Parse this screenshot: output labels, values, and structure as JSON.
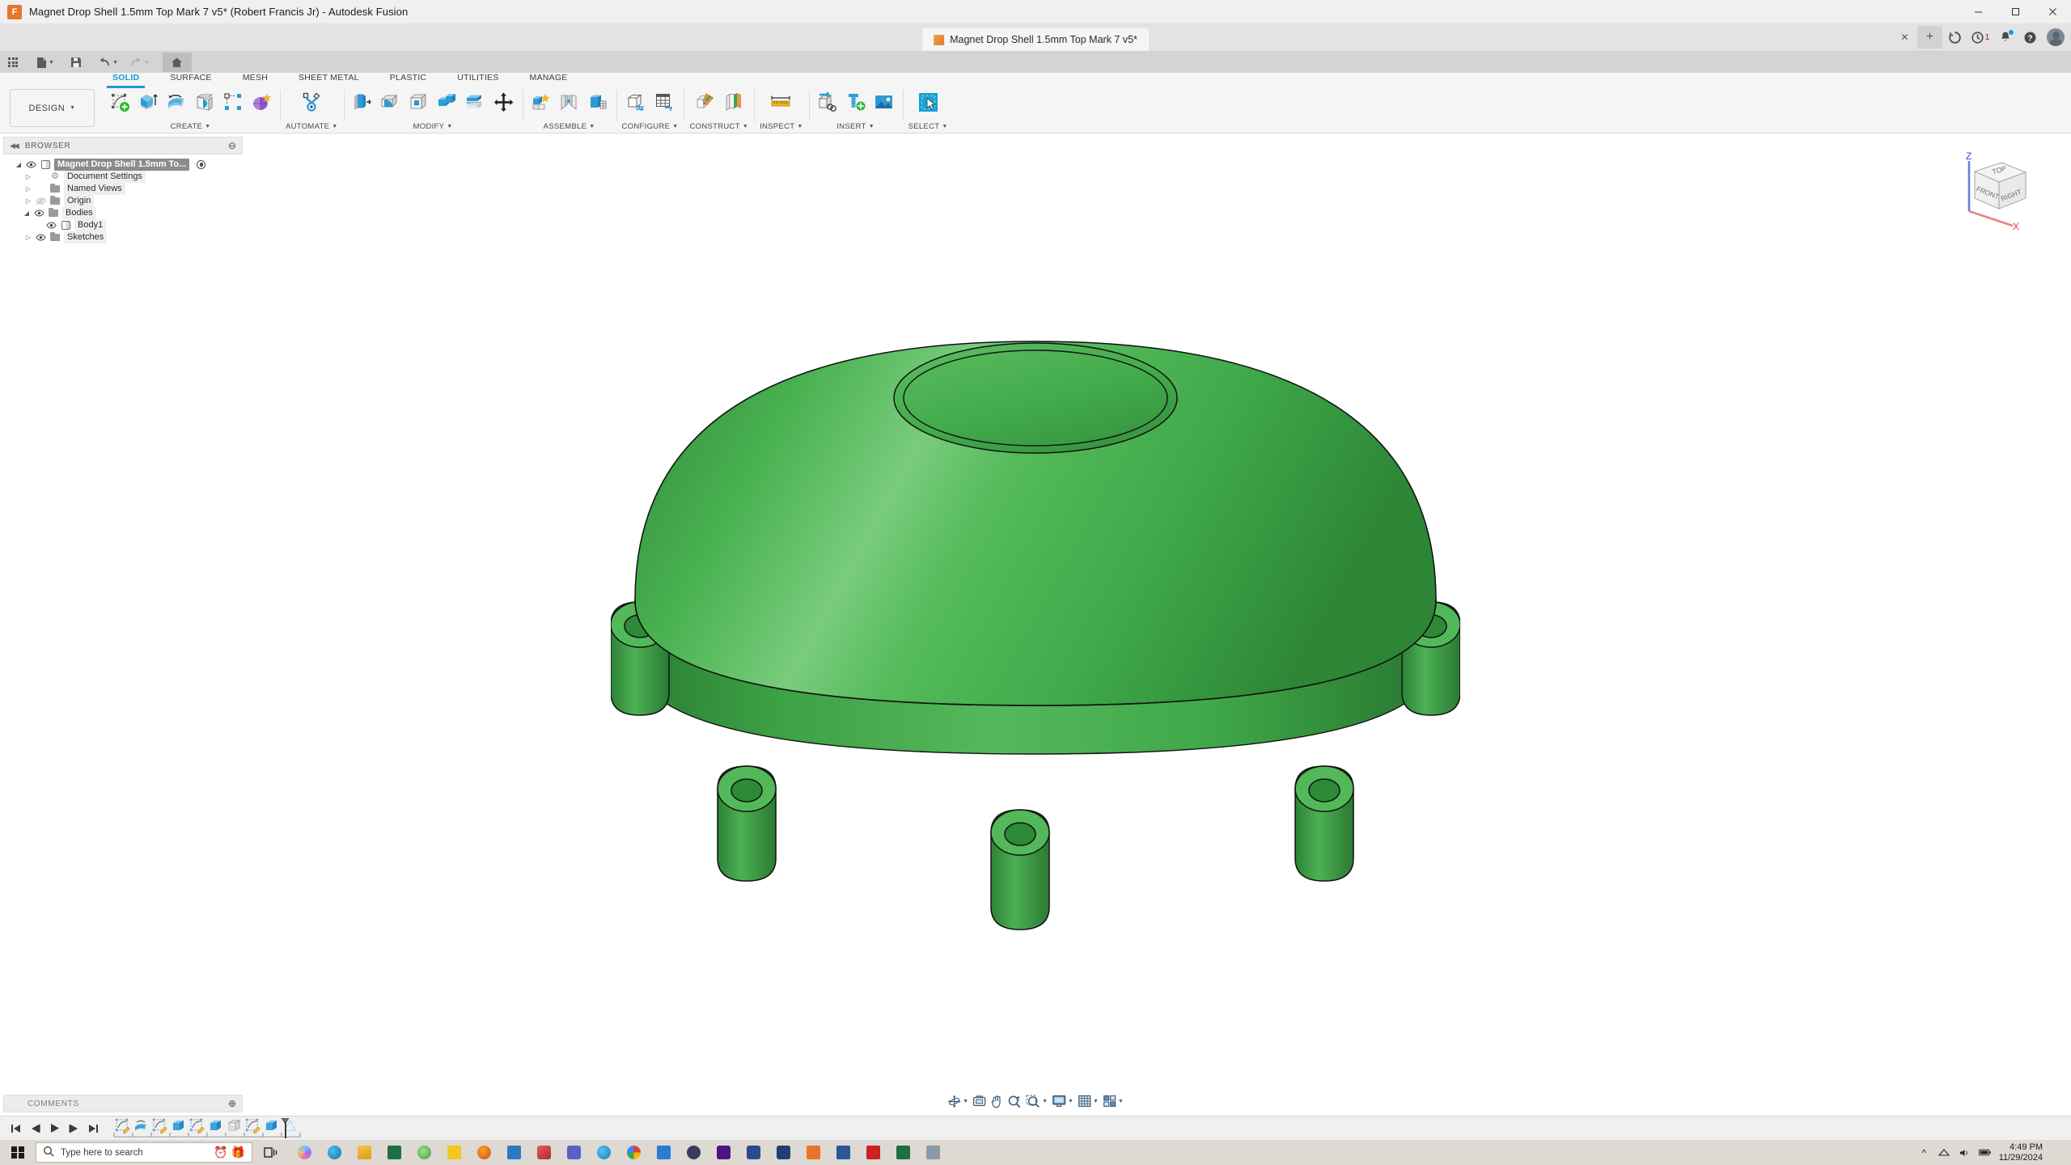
{
  "window": {
    "title": "Magnet Drop Shell 1.5mm Top Mark 7 v5* (Robert Francis Jr) - Autodesk Fusion",
    "app_icon": "fusion-logo-icon",
    "minimize": "—",
    "maximize": "□",
    "close": "✕"
  },
  "appbar": {
    "document_tab": "Magnet Drop Shell 1.5mm Top Mark 7 v5*",
    "tab_close": "✕",
    "new_tab": "+",
    "icons": [
      {
        "name": "job-status-icon",
        "glyph": "◔"
      },
      {
        "name": "recent-activity-icon",
        "glyph": "◔",
        "badge": "1"
      },
      {
        "name": "notifications-bell-icon",
        "glyph": "🔔",
        "dot": true
      },
      {
        "name": "help-icon",
        "glyph": "?"
      },
      {
        "name": "user-avatar",
        "glyph": ""
      }
    ]
  },
  "quick_access": {
    "items": [
      {
        "name": "app-grid-button",
        "label": "",
        "icon": "grid-9-icon"
      },
      {
        "name": "new-file-button",
        "label": "",
        "icon": "file-icon",
        "caret": true
      },
      {
        "name": "save-button",
        "label": "",
        "icon": "save-disk-icon"
      },
      {
        "name": "undo-button",
        "label": "",
        "icon": "undo-arrow-icon",
        "caret": true
      },
      {
        "name": "redo-button",
        "label": "",
        "icon": "redo-arrow-icon",
        "caret": true
      },
      {
        "name": "home-button",
        "label": "",
        "icon": "home-icon",
        "active": true
      }
    ]
  },
  "ribbon": {
    "workspace": "DESIGN",
    "tabs": [
      {
        "label": "SOLID",
        "active": true
      },
      {
        "label": "SURFACE",
        "active": false
      },
      {
        "label": "MESH",
        "active": false
      },
      {
        "label": "SHEET METAL",
        "active": false
      },
      {
        "label": "PLASTIC",
        "active": false
      },
      {
        "label": "UTILITIES",
        "active": false
      },
      {
        "label": "MANAGE",
        "active": false
      }
    ],
    "panels": [
      {
        "label": "CREATE",
        "tools": [
          {
            "name": "create-sketch-icon"
          },
          {
            "name": "extrude-icon"
          },
          {
            "name": "revolve-icon"
          },
          {
            "name": "sweep-icon"
          },
          {
            "name": "pattern-icon"
          },
          {
            "name": "create-form-icon"
          }
        ]
      },
      {
        "label": "AUTOMATE",
        "tools": [
          {
            "name": "automated-modeling-icon"
          }
        ]
      },
      {
        "label": "MODIFY",
        "tools": [
          {
            "name": "press-pull-icon"
          },
          {
            "name": "fillet-icon"
          },
          {
            "name": "shell-icon"
          },
          {
            "name": "combine-icon"
          },
          {
            "name": "split-face-icon"
          },
          {
            "name": "move-copy-icon"
          }
        ]
      },
      {
        "label": "ASSEMBLE",
        "tools": [
          {
            "name": "new-component-icon"
          },
          {
            "name": "joint-icon"
          },
          {
            "name": "rigid-group-icon"
          }
        ]
      },
      {
        "label": "CONFIGURE",
        "tools": [
          {
            "name": "configure-design-icon"
          },
          {
            "name": "configuration-table-icon"
          }
        ]
      },
      {
        "label": "CONSTRUCT",
        "tools": [
          {
            "name": "offset-plane-icon"
          },
          {
            "name": "plane-through-points-icon"
          }
        ]
      },
      {
        "label": "INSPECT",
        "tools": [
          {
            "name": "measure-ruler-icon"
          }
        ]
      },
      {
        "label": "INSERT",
        "tools": [
          {
            "name": "insert-derive-icon"
          },
          {
            "name": "insert-mcmaster-icon"
          },
          {
            "name": "insert-canvas-icon"
          }
        ]
      },
      {
        "label": "SELECT",
        "tools": [
          {
            "name": "select-cursor-icon"
          }
        ]
      }
    ]
  },
  "browser": {
    "header": "BROWSER",
    "collapse_icon": "◀◀",
    "options_icon": "⊖",
    "tree": [
      {
        "label": "Magnet Drop Shell 1.5mm To...",
        "icon": "component-icon",
        "indent": 0,
        "expander": "open",
        "eye": "visible",
        "selected": true,
        "radio": true,
        "name": "browser-root-component"
      },
      {
        "label": "Document Settings",
        "icon": "gear-icon",
        "indent": 1,
        "expander": "closed",
        "eye": "none",
        "name": "browser-document-settings"
      },
      {
        "label": "Named Views",
        "icon": "folder-icon",
        "indent": 1,
        "expander": "closed",
        "eye": "none",
        "name": "browser-named-views"
      },
      {
        "label": "Origin",
        "icon": "folder-icon",
        "indent": 1,
        "expander": "closed",
        "eye": "hidden",
        "name": "browser-origin"
      },
      {
        "label": "Bodies",
        "icon": "folder-icon",
        "indent": 1,
        "expander": "open",
        "eye": "visible",
        "name": "browser-bodies"
      },
      {
        "label": "Body1",
        "icon": "body-icon",
        "indent": 2,
        "expander": "none",
        "eye": "visible",
        "name": "browser-body1"
      },
      {
        "label": "Sketches",
        "icon": "folder-icon",
        "indent": 1,
        "expander": "closed",
        "eye": "visible",
        "name": "browser-sketches"
      }
    ]
  },
  "comments": {
    "header": "COMMENTS",
    "add_icon": "⊕"
  },
  "viewcube": {
    "face_top": "TOP",
    "face_front": "FRONT",
    "face_right": "RIGHT",
    "axis_z": "Z",
    "axis_x": "X",
    "axis_z_color": "#2b4ed6",
    "axis_x_color": "#e03a3a"
  },
  "navbar": {
    "items": [
      {
        "name": "orbit-button",
        "icon": "orbit-icon",
        "caret": true
      },
      {
        "name": "look-at-button",
        "icon": "look-at-icon",
        "caret": false
      },
      {
        "name": "pan-button",
        "icon": "pan-hand-icon",
        "caret": false
      },
      {
        "name": "zoom-button",
        "icon": "zoom-magnifier-icon",
        "caret": false
      },
      {
        "name": "fit-button",
        "icon": "zoom-fit-icon",
        "caret": true
      },
      {
        "name": "display-settings-button",
        "icon": "monitor-icon",
        "caret": true
      },
      {
        "name": "grid-snaps-button",
        "icon": "grid-icon",
        "caret": true
      },
      {
        "name": "viewports-button",
        "icon": "viewports-icon",
        "caret": true
      }
    ]
  },
  "timeline": {
    "playback": [
      {
        "name": "timeline-go-start",
        "glyph": "⏮"
      },
      {
        "name": "timeline-step-back",
        "glyph": "◀"
      },
      {
        "name": "timeline-play",
        "glyph": "▶"
      },
      {
        "name": "timeline-step-forward",
        "glyph": "▶"
      },
      {
        "name": "timeline-go-end",
        "glyph": "⏭"
      }
    ],
    "features": [
      {
        "name": "timeline-feature-sketch-1",
        "type": "sketch"
      },
      {
        "name": "timeline-feature-revolve-1",
        "type": "revolve"
      },
      {
        "name": "timeline-feature-sketch-2",
        "type": "sketch"
      },
      {
        "name": "timeline-feature-extrude-1",
        "type": "extrude"
      },
      {
        "name": "timeline-feature-sketch-3",
        "type": "sketch"
      },
      {
        "name": "timeline-feature-extrude-2",
        "type": "extrude"
      },
      {
        "name": "timeline-feature-fillet-1",
        "type": "fillet"
      },
      {
        "name": "timeline-feature-sketch-4",
        "type": "sketch"
      },
      {
        "name": "timeline-feature-extrude-3",
        "type": "extrude"
      },
      {
        "name": "timeline-feature-ghost",
        "type": "ghost"
      }
    ]
  },
  "taskbar": {
    "search_placeholder": "Type here to search",
    "start_icon": "windows-logo-icon",
    "search_icon": "search-icon",
    "pinned_inline": [
      {
        "name": "clock-widget-icon",
        "glyph": "⏰"
      },
      {
        "name": "gift-widget-icon",
        "glyph": "🎁"
      }
    ],
    "task_view_icon": "task-view-icon",
    "apps": [
      {
        "name": "taskbar-copilot",
        "color": "#8b5cf6"
      },
      {
        "name": "taskbar-edge",
        "color": "#1b8ac7"
      },
      {
        "name": "taskbar-file-explorer",
        "color": "#f0b429"
      },
      {
        "name": "taskbar-excel",
        "color": "#1d7044"
      },
      {
        "name": "taskbar-chrome-alt",
        "color": "#4aaa4a"
      },
      {
        "name": "taskbar-notes",
        "color": "#f3c623"
      },
      {
        "name": "taskbar-firefox",
        "color": "#e35a2b"
      },
      {
        "name": "taskbar-store",
        "color": "#2a7ac0"
      },
      {
        "name": "taskbar-paint",
        "color": "#d94f4f"
      },
      {
        "name": "taskbar-teams",
        "color": "#5b5fc7"
      },
      {
        "name": "taskbar-edge-2",
        "color": "#2f9fd6"
      },
      {
        "name": "taskbar-chrome",
        "color": "#3b80f0"
      },
      {
        "name": "taskbar-vscode",
        "color": "#2b7cd3"
      },
      {
        "name": "taskbar-obs",
        "color": "#3b3b5c"
      },
      {
        "name": "taskbar-premiere",
        "color": "#6b34b5"
      },
      {
        "name": "taskbar-lightroom",
        "color": "#2a4b8d"
      },
      {
        "name": "taskbar-photoshop",
        "color": "#1d3f73"
      },
      {
        "name": "taskbar-fusion",
        "color": "#e8742c"
      },
      {
        "name": "taskbar-word",
        "color": "#2b5797"
      },
      {
        "name": "taskbar-acrobat",
        "color": "#cc2222"
      },
      {
        "name": "taskbar-excel-2",
        "color": "#1d7044"
      },
      {
        "name": "taskbar-misc",
        "color": "#8a9aa8"
      }
    ],
    "tray": {
      "time": "4:49 PM",
      "date": "11/29/2024"
    }
  },
  "model": {
    "name": "magnet-drop-shell-3d-body",
    "body_color": "#3fa848",
    "body_color_light": "#63bf68",
    "body_color_dark": "#2f8a38",
    "edge_color": "#111111",
    "description": "Green dome-shaped shell with six perimeter bosses and a central boss"
  }
}
